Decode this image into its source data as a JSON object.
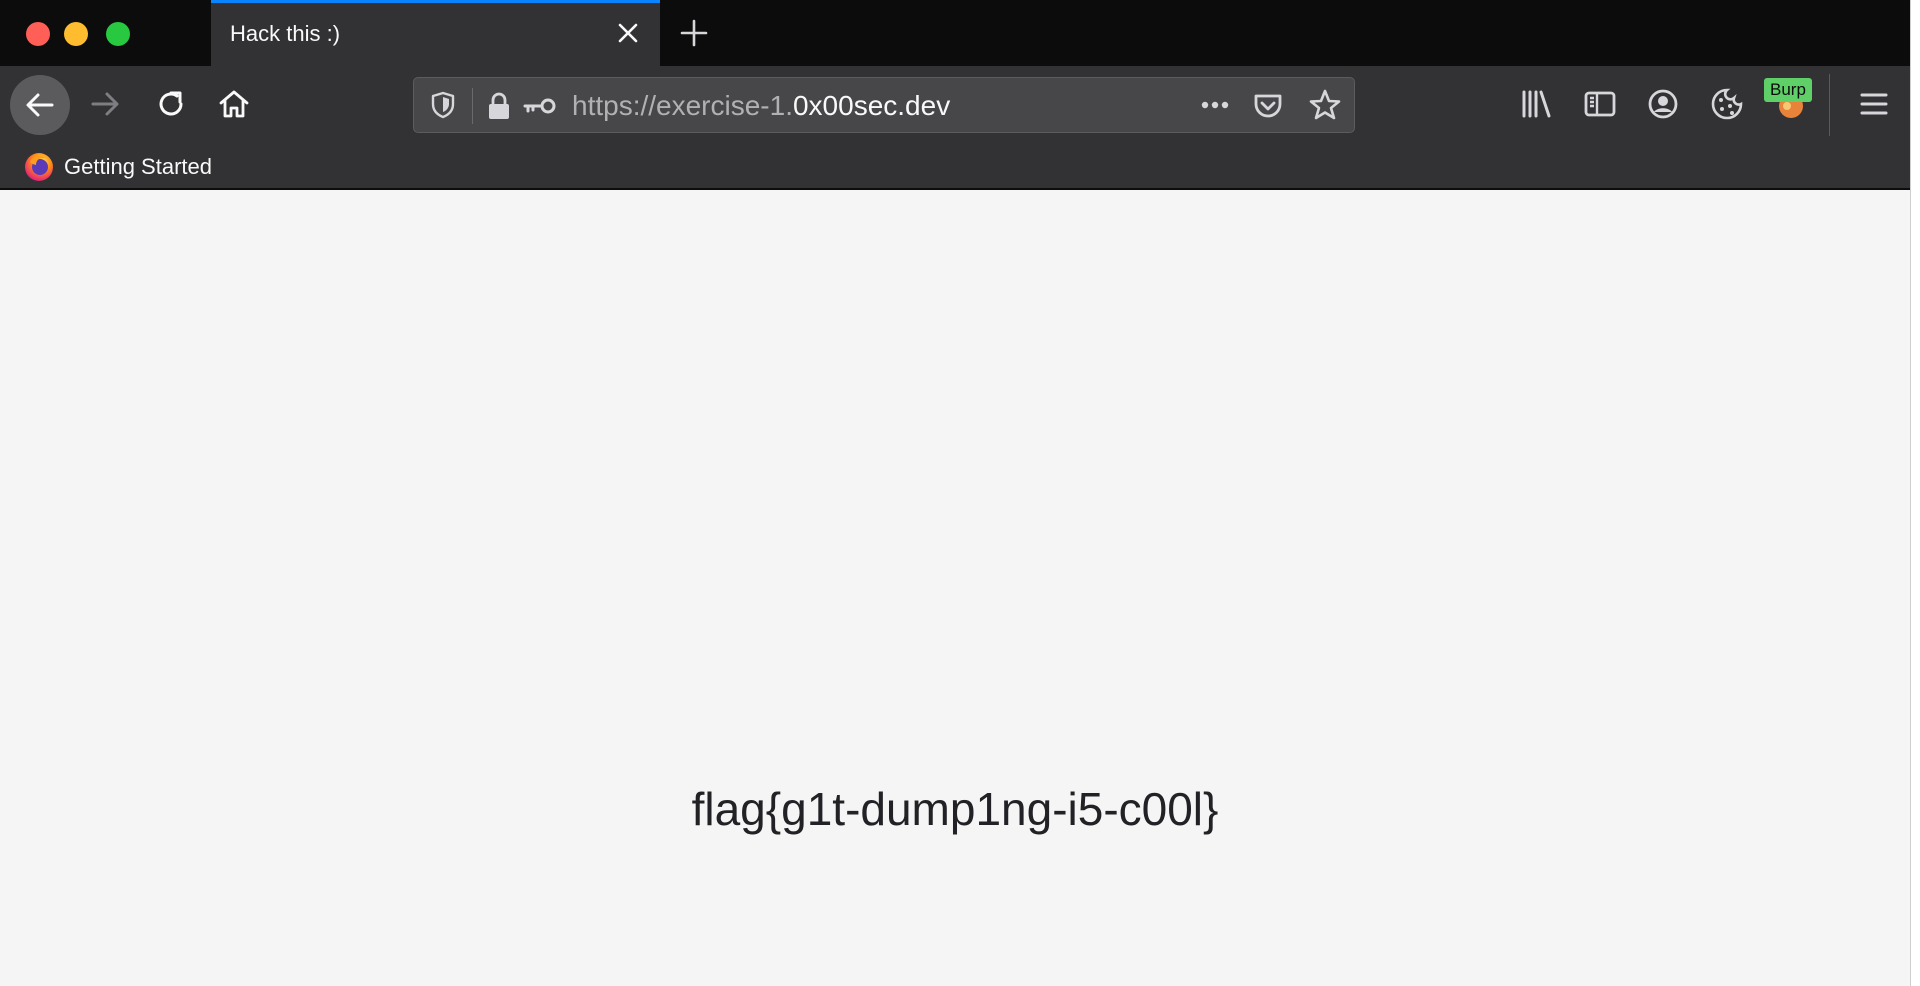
{
  "window": {
    "tab": {
      "title": "Hack this :)"
    }
  },
  "toolbar": {
    "url": {
      "scheme_prefix": "https://exercise-1.",
      "host": "0x00sec.dev"
    },
    "burp_badge": "Burp"
  },
  "bookmarks": [
    {
      "label": "Getting Started",
      "icon": "firefox-icon"
    }
  ],
  "page": {
    "flag_text": "flag{g1t-dump1ng-i5-c00l}"
  },
  "colors": {
    "tab_accent": "#0a84ff",
    "toolbar_bg": "#323234",
    "tabstrip_bg": "#0c0c0d",
    "content_bg": "#f5f5f5",
    "burp_badge": "#5fd068"
  }
}
